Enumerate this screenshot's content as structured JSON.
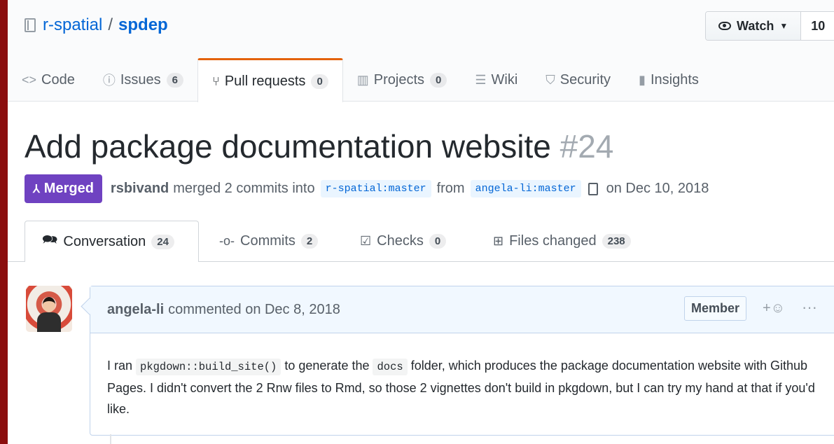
{
  "repo": {
    "owner": "r-spatial",
    "separator": "/",
    "name": "spdep"
  },
  "watch": {
    "label": "Watch",
    "count": "10"
  },
  "nav": [
    {
      "icon": "<>",
      "label": "Code",
      "counter": ""
    },
    {
      "icon": "ⓘ",
      "label": "Issues",
      "counter": "6"
    },
    {
      "icon": "⑂",
      "label": "Pull requests",
      "counter": "0"
    },
    {
      "icon": "▥",
      "label": "Projects",
      "counter": "0"
    },
    {
      "icon": "☰",
      "label": "Wiki",
      "counter": ""
    },
    {
      "icon": "⛉",
      "label": "Security",
      "counter": ""
    },
    {
      "icon": "▮",
      "label": "Insights",
      "counter": ""
    }
  ],
  "pr": {
    "title": "Add package documentation website",
    "number": "#24",
    "state": "Merged",
    "author": "rsbivand",
    "action": "merged 2 commits into",
    "base": "r-spatial:master",
    "from": "from",
    "head": "angela-li:master",
    "date": "on Dec 10, 2018"
  },
  "tabs": [
    {
      "label": "Conversation",
      "counter": "24"
    },
    {
      "label": "Commits",
      "counter": "2"
    },
    {
      "label": "Checks",
      "counter": "0"
    },
    {
      "label": "Files changed",
      "counter": "238"
    }
  ],
  "comment": {
    "author": "angela-li",
    "meta": "commented on Dec 8, 2018",
    "badge": "Member",
    "reaction": "+☺",
    "more": "···",
    "body_1": "I ran ",
    "code_1": "pkgdown::build_site()",
    "body_2": " to generate the ",
    "code_2": "docs",
    "body_3": " folder, which produces the package documentation website with Github Pages. I didn't convert the 2 Rnw files to Rmd, so those 2 vignettes don't build in pkgdown, but I can try my hand at that if you'd like."
  }
}
